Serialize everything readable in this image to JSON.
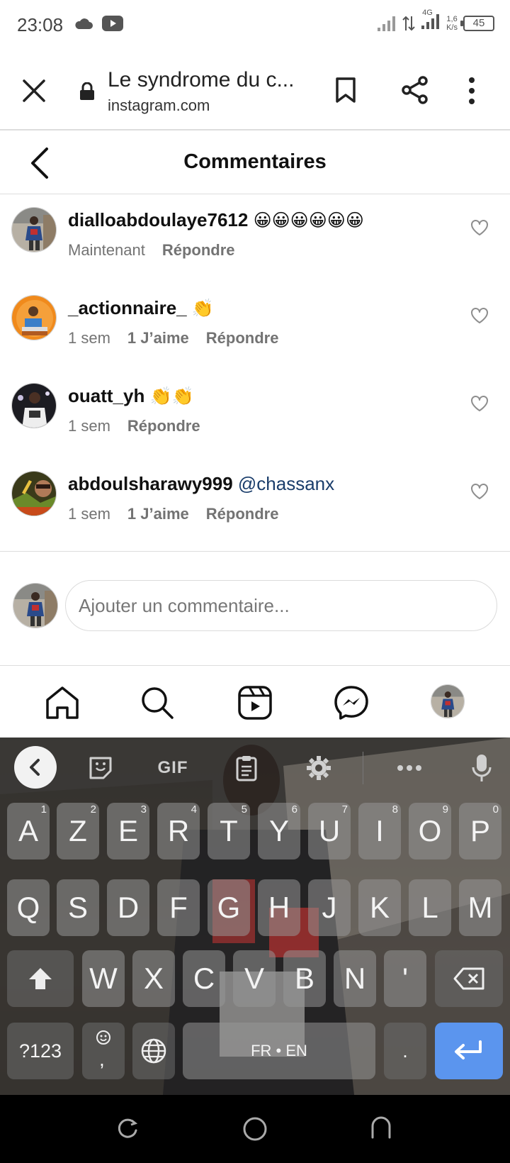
{
  "status_bar": {
    "time": "23:08",
    "network": "4G",
    "speed_value": "1,6",
    "speed_unit": "K/s",
    "battery": "45"
  },
  "browser": {
    "title": "Le syndrome du c...",
    "domain": "instagram.com"
  },
  "header": {
    "title": "Commentaires"
  },
  "comments": [
    {
      "username": "dialloabdoulaye7612",
      "text": "😀😀😀😀😀😀",
      "time": "Maintenant",
      "likes": "",
      "reply": "Répondre"
    },
    {
      "username": "_actionnaire_",
      "text": "👏",
      "time": "1 sem",
      "likes": "1 J’aime",
      "reply": "Répondre"
    },
    {
      "username": "ouatt_yh",
      "text": "👏👏",
      "time": "1 sem",
      "likes": "",
      "reply": "Répondre"
    },
    {
      "username": "abdoulsharawy999",
      "text": "@chassanx",
      "time": "1 sem",
      "likes": "1 J’aime",
      "reply": "Répondre"
    }
  ],
  "compose": {
    "placeholder": "Ajouter un commentaire..."
  },
  "keyboard": {
    "toolbar": {
      "gif": "GIF"
    },
    "row1": [
      {
        "key": "A",
        "hint": "1"
      },
      {
        "key": "Z",
        "hint": "2"
      },
      {
        "key": "E",
        "hint": "3"
      },
      {
        "key": "R",
        "hint": "4"
      },
      {
        "key": "T",
        "hint": "5"
      },
      {
        "key": "Y",
        "hint": "6"
      },
      {
        "key": "U",
        "hint": "7"
      },
      {
        "key": "I",
        "hint": "8"
      },
      {
        "key": "O",
        "hint": "9"
      },
      {
        "key": "P",
        "hint": "0"
      }
    ],
    "row2": [
      "Q",
      "S",
      "D",
      "F",
      "G",
      "H",
      "J",
      "K",
      "L",
      "M"
    ],
    "row3": [
      "W",
      "X",
      "C",
      "V",
      "B",
      "N",
      "'"
    ],
    "symbols_key": "?123",
    "comma_key": ",",
    "space_label": "FR • EN",
    "period_key": "."
  }
}
